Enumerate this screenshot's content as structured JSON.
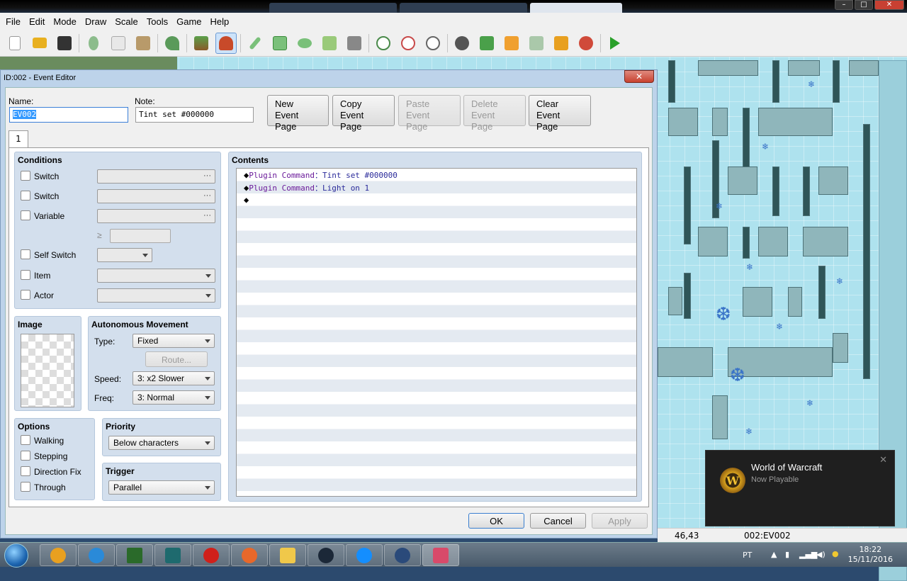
{
  "menubar": [
    "File",
    "Edit",
    "Mode",
    "Draw",
    "Scale",
    "Tools",
    "Game",
    "Help"
  ],
  "toolbar_icons": [
    "new-project-icon",
    "open-project-icon",
    "save-project-icon",
    "cut-icon",
    "copy-icon",
    "paste-icon",
    "undo-icon",
    "map-mode-icon",
    "event-mode-icon",
    "pencil-icon",
    "rectangle-icon",
    "ellipse-icon",
    "flood-fill-icon",
    "shadow-pen-icon",
    "zoom-in-icon",
    "zoom-out-icon",
    "actual-size-icon",
    "database-icon",
    "plugin-manager-icon",
    "sound-test-icon",
    "event-searcher-icon",
    "resource-manager-icon",
    "character-generator-icon",
    "playtest-icon"
  ],
  "dialog": {
    "title": "ID:002 - Event Editor",
    "close": "✕",
    "name_label": "Name:",
    "name_value": "EV002",
    "note_label": "Note:",
    "note_value": "Tint set #000000",
    "buttons": {
      "new_page": [
        "New",
        "Event Page"
      ],
      "copy_page": [
        "Copy",
        "Event Page"
      ],
      "paste_page": [
        "Paste",
        "Event Page"
      ],
      "delete_page": [
        "Delete",
        "Event Page"
      ],
      "clear_page": [
        "Clear",
        "Event Page"
      ]
    },
    "tab": "1",
    "conditions": {
      "title": "Conditions",
      "switch1": "Switch",
      "switch2": "Switch",
      "variable": "Variable",
      "gte": "≥",
      "self_switch": "Self Switch",
      "item": "Item",
      "actor": "Actor",
      "dots": "···"
    },
    "image": {
      "title": "Image"
    },
    "movement": {
      "title": "Autonomous Movement",
      "type_label": "Type:",
      "type_value": "Fixed",
      "route": "Route...",
      "speed_label": "Speed:",
      "speed_value": "3: x2 Slower",
      "freq_label": "Freq:",
      "freq_value": "3: Normal"
    },
    "options": {
      "title": "Options",
      "walking": "Walking",
      "stepping": "Stepping",
      "direction_fix": "Direction Fix",
      "through": "Through"
    },
    "priority": {
      "title": "Priority",
      "value": "Below characters"
    },
    "trigger": {
      "title": "Trigger",
      "value": "Parallel"
    },
    "contents": {
      "title": "Contents",
      "commands": [
        {
          "type": "Plugin Command",
          "sep": "：",
          "arg": "Tint set #000000"
        },
        {
          "type": "Plugin Command",
          "sep": "：",
          "arg": "Light on 1"
        },
        {
          "type": "",
          "sep": "",
          "arg": ""
        }
      ],
      "bullet": "◆"
    },
    "ok": "OK",
    "cancel": "Cancel",
    "apply": "Apply"
  },
  "statusbar": {
    "coords": "46,43",
    "event": "002:EV002"
  },
  "toast": {
    "title": "World of Warcraft",
    "subtitle": "Now Playable",
    "close": "✕",
    "logo": "W"
  },
  "taskbar": {
    "apps": [
      "explorer-icon",
      "internet-explorer-icon",
      "task-manager-icon",
      "maya-icon",
      "opera-icon",
      "firefox-icon",
      "file-explorer-icon",
      "steam-icon",
      "battle-net-icon",
      "teamspeak-icon",
      "rpg-maker-icon"
    ],
    "lang": "PT",
    "time": "18:22",
    "date": "15/11/2016"
  },
  "colors": {
    "dialog_border": "#bdd3ea",
    "panel": "#d3dfed",
    "map_ice": "#aee2ee",
    "command_text": "#2a2a9a"
  }
}
